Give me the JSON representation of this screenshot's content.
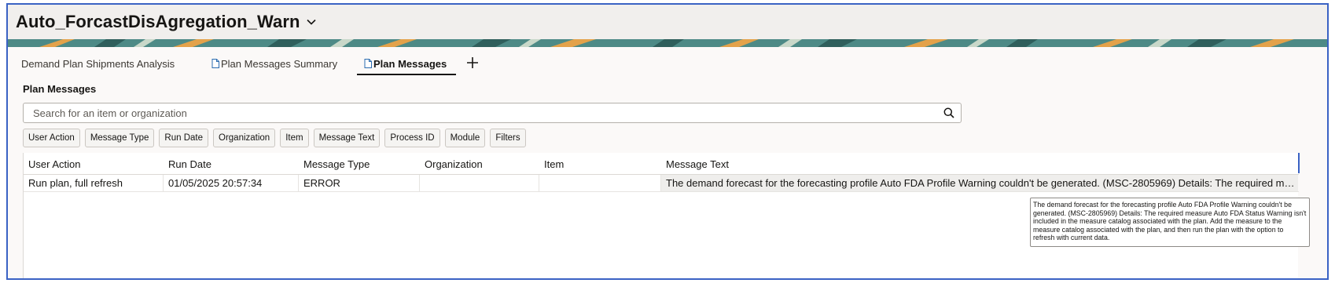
{
  "header": {
    "title": "Auto_ForcastDisAgregation_Warn",
    "chevron_icon": "chevron-down-icon"
  },
  "tabs": [
    {
      "label": "Demand Plan Shipments Analysis",
      "icon": "",
      "active": false
    },
    {
      "label": "Plan Messages Summary",
      "icon": "document-icon",
      "active": false
    },
    {
      "label": "Plan Messages",
      "icon": "document-icon",
      "active": true
    }
  ],
  "add_tab_icon": "plus-icon",
  "section": {
    "title": "Plan Messages"
  },
  "search": {
    "placeholder": "Search for an item or organization",
    "value": "",
    "icon": "search-icon"
  },
  "filter_chips": [
    "User Action",
    "Message Type",
    "Run Date",
    "Organization",
    "Item",
    "Message Text",
    "Process ID",
    "Module",
    "Filters"
  ],
  "table": {
    "columns": [
      "User Action",
      "Run Date",
      "Message Type",
      "Organization",
      "Item",
      "Message Text"
    ],
    "rows": [
      {
        "user_action": "Run plan, full refresh",
        "run_date": "01/05/2025 20:57:34",
        "message_type": "ERROR",
        "organization": "",
        "item": "",
        "message_text": "The demand forecast for the forecasting profile Auto FDA Profile Warning couldn't be generated. (MSC-2805969) Details: The required me..."
      }
    ]
  },
  "tooltip": {
    "text": "The demand forecast for the forecasting profile Auto FDA Profile Warning couldn't be generated. (MSC-2805969) Details: The required measure Auto FDA Status Warning isn't included in the measure catalog associated with the plan. Add the measure to the measure catalog associated with the plan, and then run the plan with the option to refresh with current data."
  },
  "colors": {
    "frame_border": "#3a62c4",
    "banner_teal": "#4d8a86",
    "banner_orange": "#e3a24a"
  }
}
